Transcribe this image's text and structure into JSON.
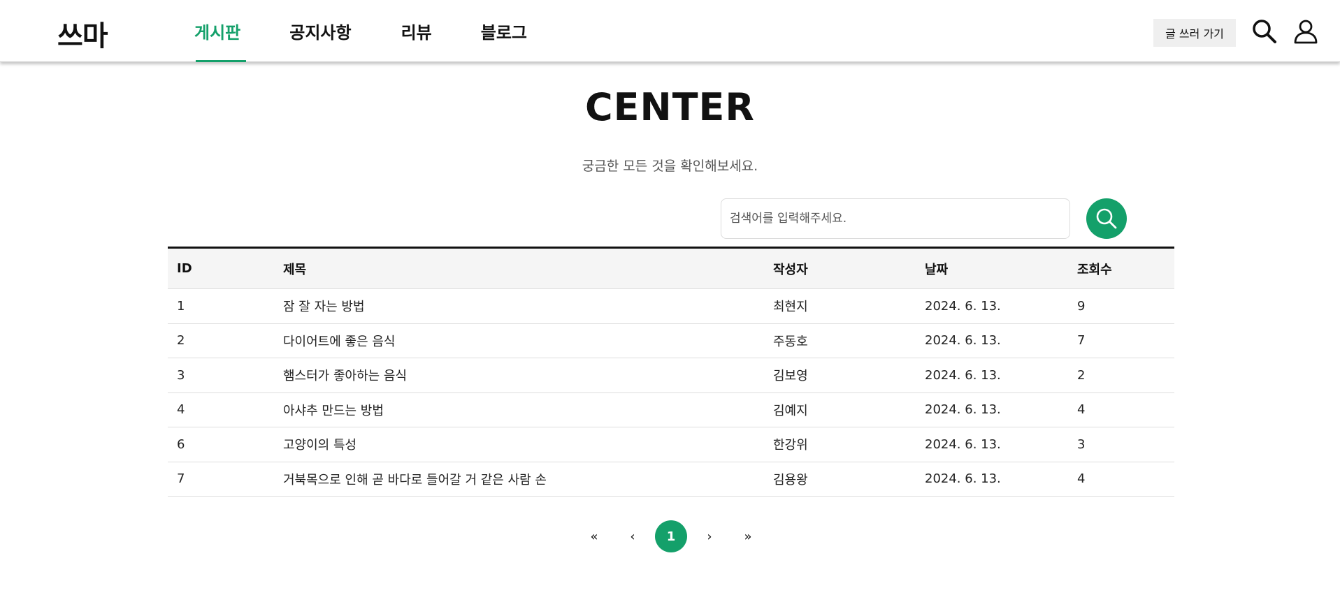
{
  "header": {
    "logo": "쓰마",
    "nav": [
      {
        "label": "게시판",
        "active": true
      },
      {
        "label": "공지사항",
        "active": false
      },
      {
        "label": "리뷰",
        "active": false
      },
      {
        "label": "블로그",
        "active": false
      }
    ],
    "write_button": "글 쓰러 가기",
    "icons": [
      "search-icon",
      "user-icon"
    ]
  },
  "main": {
    "title": "CENTER",
    "subtitle": "궁금한 모든 것을 확인해보세요.",
    "search": {
      "placeholder": "검색어를 입력해주세요.",
      "value": ""
    }
  },
  "table": {
    "columns": [
      "ID",
      "제목",
      "작성자",
      "날짜",
      "조회수"
    ],
    "rows": [
      {
        "id": "1",
        "title": "잠 잘 자는 방법",
        "author": "최현지",
        "date": "2024. 6. 13.",
        "views": "9"
      },
      {
        "id": "2",
        "title": "다이어트에 좋은 음식",
        "author": "주동호",
        "date": "2024. 6. 13.",
        "views": "7"
      },
      {
        "id": "3",
        "title": "햄스터가 좋아하는 음식",
        "author": "김보영",
        "date": "2024. 6. 13.",
        "views": "2"
      },
      {
        "id": "4",
        "title": "아샤추 만드는 방법",
        "author": "김예지",
        "date": "2024. 6. 13.",
        "views": "4"
      },
      {
        "id": "6",
        "title": "고양이의 특성",
        "author": "한강위",
        "date": "2024. 6. 13.",
        "views": "3"
      },
      {
        "id": "7",
        "title": "거북목으로 인해 곧 바다로 들어갈 거 같은 사람 손",
        "author": "김용왕",
        "date": "2024. 6. 13.",
        "views": "4"
      }
    ]
  },
  "pagination": {
    "first": "«",
    "prev": "‹",
    "current": "1",
    "next": "›",
    "last": "»"
  },
  "colors": {
    "accent": "#14a06a",
    "header_bg": "#ffffff",
    "table_header_bg": "#f5f5f5",
    "write_button_bg": "#efefef"
  }
}
